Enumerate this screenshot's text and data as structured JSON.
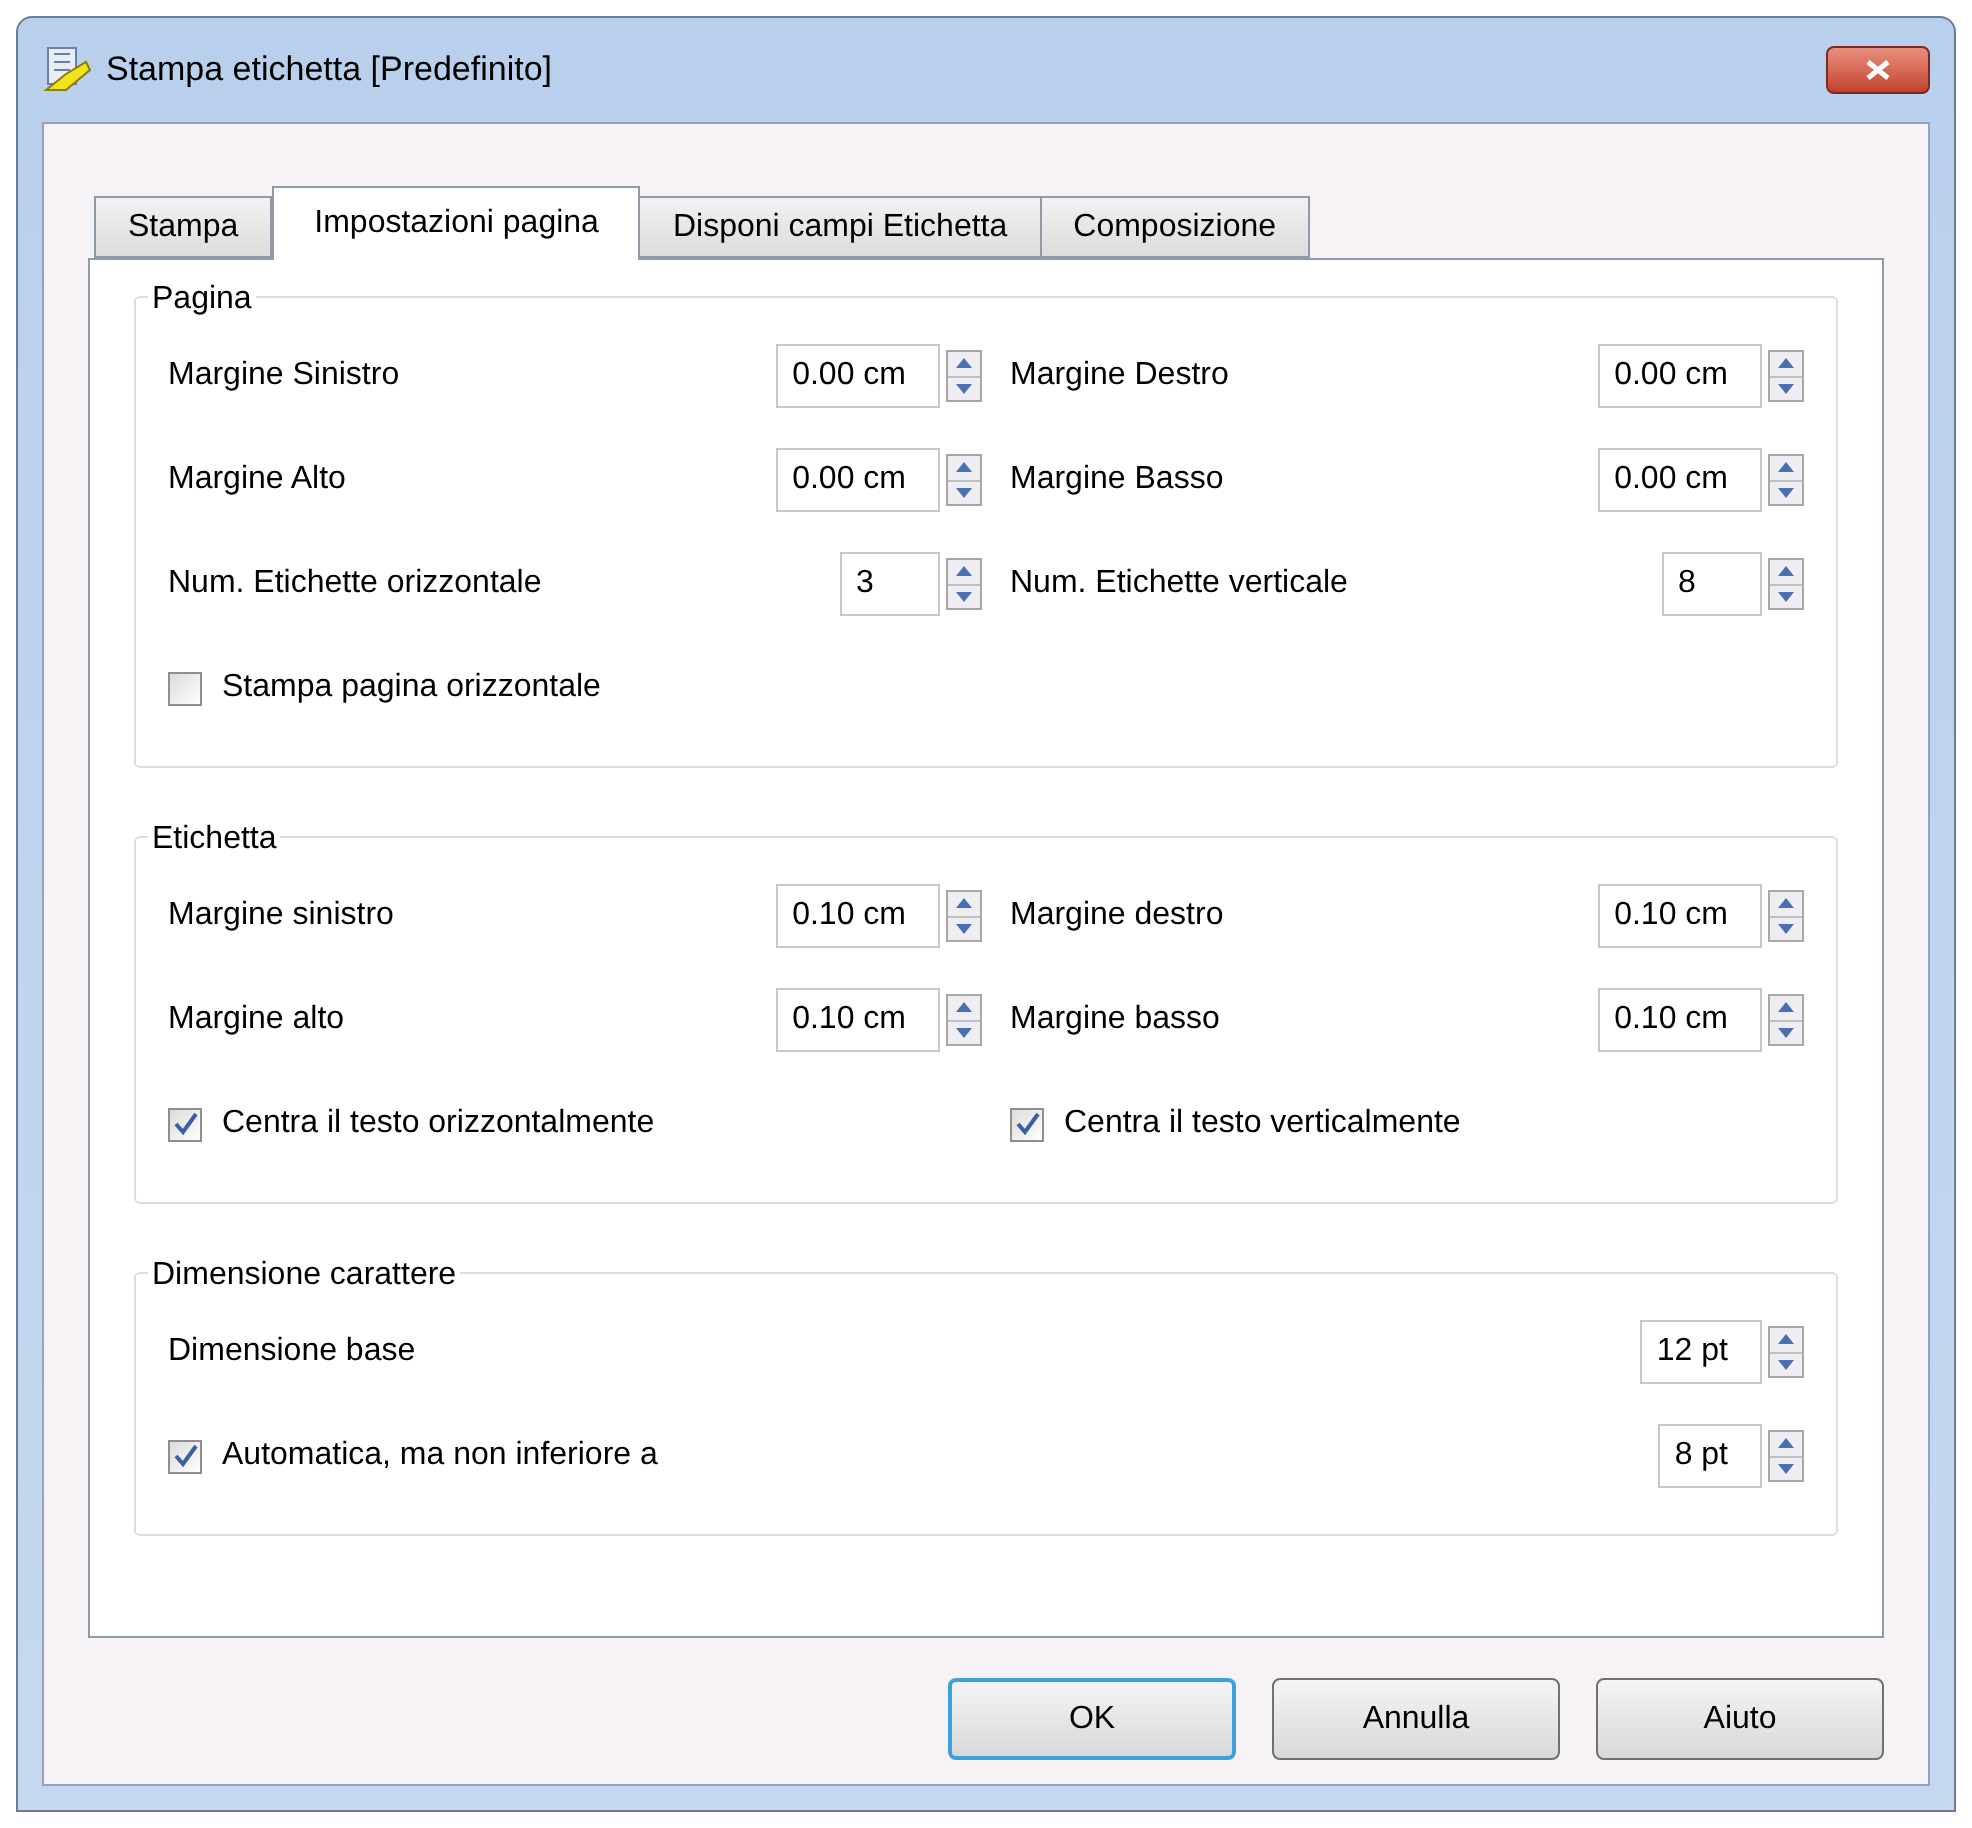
{
  "window": {
    "title": "Stampa etichetta [Predefinito]"
  },
  "tabs": [
    {
      "label": "Stampa",
      "selected": false
    },
    {
      "label": "Impostazioni pagina",
      "selected": true
    },
    {
      "label": "Disponi campi Etichetta",
      "selected": false
    },
    {
      "label": "Composizione",
      "selected": false
    }
  ],
  "groups": [
    {
      "title": "Pagina",
      "rows": [
        [
          {
            "kind": "spin",
            "label": "Margine Sinistro",
            "value": "0.00 cm"
          },
          {
            "kind": "spin",
            "label": "Margine Destro",
            "value": "0.00 cm"
          }
        ],
        [
          {
            "kind": "spin",
            "label": "Margine Alto",
            "value": "0.00 cm"
          },
          {
            "kind": "spin",
            "label": "Margine Basso",
            "value": "0.00 cm"
          }
        ],
        [
          {
            "kind": "spin",
            "label": "Num. Etichette orizzontale",
            "value": "3"
          },
          {
            "kind": "spin",
            "label": "Num. Etichette verticale",
            "value": "8"
          }
        ],
        [
          {
            "kind": "check",
            "label": "Stampa pagina orizzontale",
            "checked": false
          }
        ]
      ]
    },
    {
      "title": "Etichetta",
      "rows": [
        [
          {
            "kind": "spin",
            "label": "Margine sinistro",
            "value": "0.10 cm"
          },
          {
            "kind": "spin",
            "label": "Margine destro",
            "value": "0.10 cm"
          }
        ],
        [
          {
            "kind": "spin",
            "label": "Margine alto",
            "value": "0.10 cm"
          },
          {
            "kind": "spin",
            "label": "Margine basso",
            "value": "0.10 cm"
          }
        ],
        [
          {
            "kind": "check",
            "label": "Centra il testo orizzontalmente",
            "checked": true
          },
          {
            "kind": "check",
            "label": "Centra il testo verticalmente",
            "checked": true
          }
        ]
      ]
    },
    {
      "title": "Dimensione carattere",
      "rows": [
        [
          {
            "kind": "spin",
            "label": "Dimensione base",
            "value": "12 pt"
          }
        ],
        [
          {
            "kind": "checkspin",
            "label": "Automatica, ma non inferiore a",
            "checked": true,
            "value": "8 pt"
          }
        ]
      ]
    }
  ],
  "buttons": [
    {
      "label": "OK",
      "default": true
    },
    {
      "label": "Annulla",
      "default": false
    },
    {
      "label": "Aiuto",
      "default": false
    }
  ]
}
